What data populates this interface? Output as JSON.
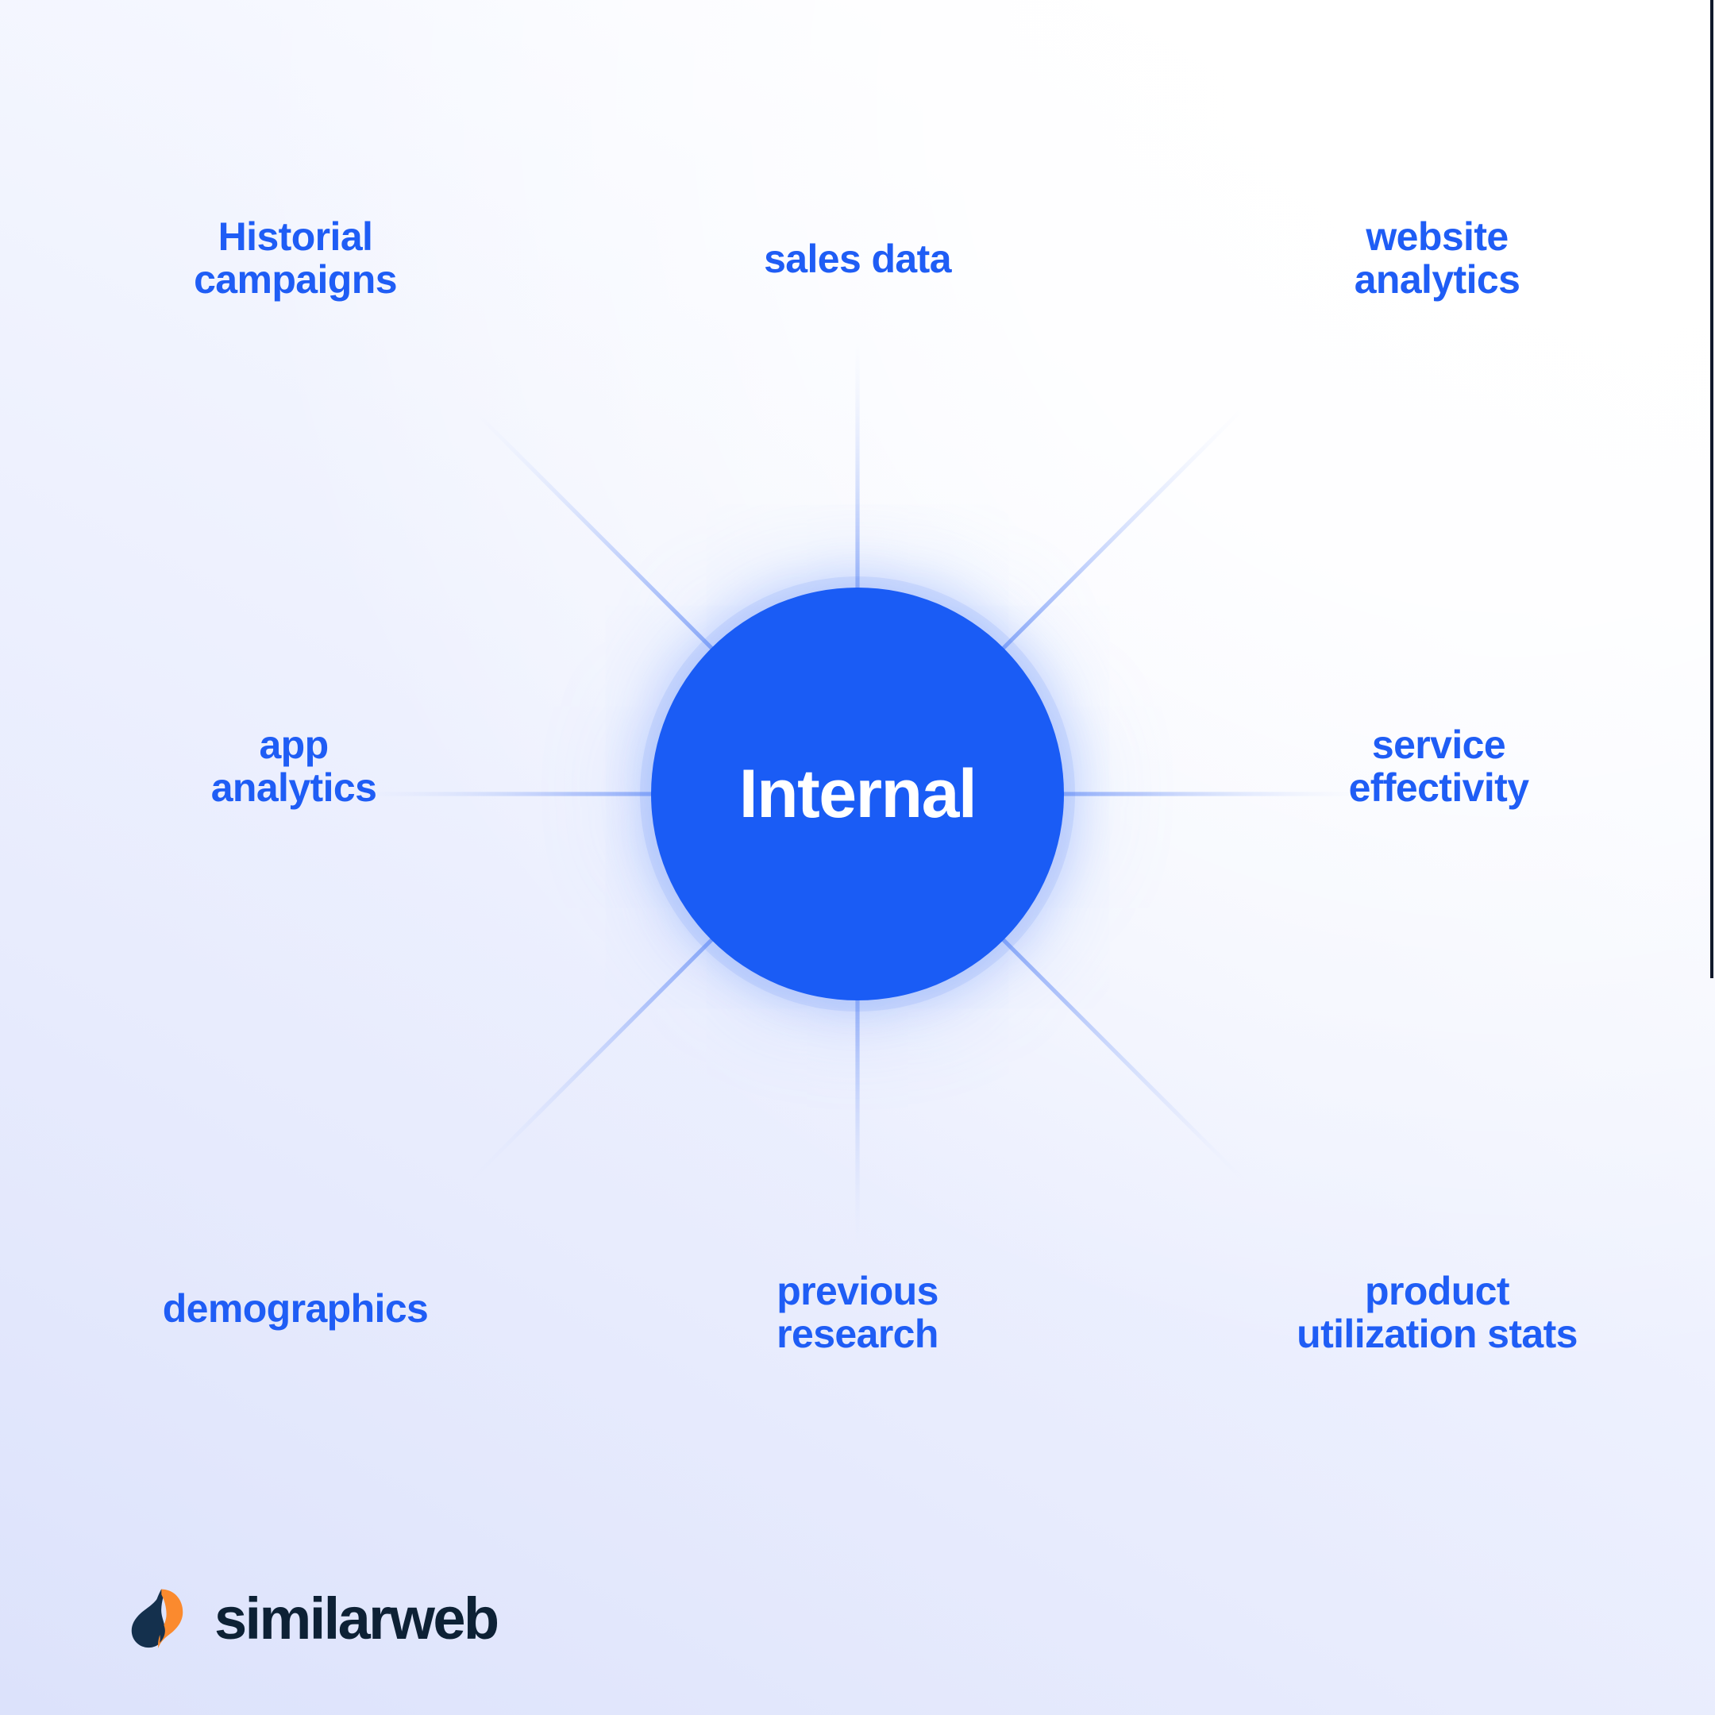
{
  "diagram": {
    "type": "radial-hub-and-spoke",
    "center": {
      "label": "Internal",
      "color": "#1a5cf5",
      "text_color": "#ffffff"
    },
    "node_label_color": "#1f5df5",
    "spoke_count": 8,
    "nodes": [
      {
        "id": "historical-campaigns",
        "label": "Historial\ncampaigns",
        "position": "top-left"
      },
      {
        "id": "sales-data",
        "label": "sales data",
        "position": "top-center"
      },
      {
        "id": "website-analytics",
        "label": "website\nanalytics",
        "position": "top-right"
      },
      {
        "id": "service-effectivity",
        "label": "service\neffectivity",
        "position": "right"
      },
      {
        "id": "product-utilization",
        "label": "product\nutilization stats",
        "position": "bottom-right"
      },
      {
        "id": "previous-research",
        "label": "previous\nresearch",
        "position": "bottom-center"
      },
      {
        "id": "demographics",
        "label": "demographics",
        "position": "bottom-left"
      },
      {
        "id": "app-analytics",
        "label": "app\nanalytics",
        "position": "left"
      }
    ]
  },
  "branding": {
    "wordmark": "similarweb",
    "mark_icon": "similarweb-logo-icon",
    "wordmark_color": "#0d2135",
    "mark_dark_color": "#14304d",
    "mark_accent_color": "#fb8a2e"
  },
  "background": {
    "gradient_from": "#dce2fb",
    "gradient_to": "#ffffff"
  },
  "chart_data": {
    "type": "diagram",
    "title": "Internal",
    "categories": [
      "Historial campaigns",
      "sales data",
      "website analytics",
      "service effectivity",
      "product utilization stats",
      "previous research",
      "demographics",
      "app analytics"
    ]
  }
}
